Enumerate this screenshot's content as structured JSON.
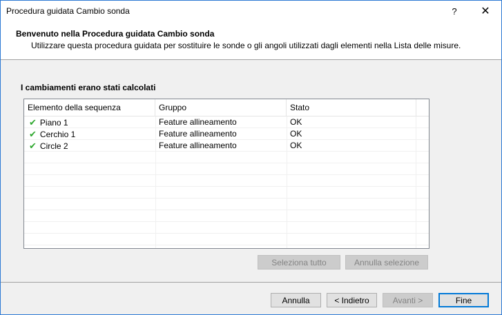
{
  "window": {
    "title": "Procedura guidata Cambio sonda",
    "help_label": "?",
    "close_label": "✕"
  },
  "header": {
    "title": "Benvenuto nella Procedura guidata Cambio sonda",
    "subtitle": "Utilizzare questa procedura guidata per sostituire le sonde o gli angoli utilizzati dagli elementi nella Lista delle misure."
  },
  "section": {
    "label": "I cambiamenti erano stati calcolati"
  },
  "table": {
    "columns": [
      "Elemento della sequenza",
      "Gruppo",
      "Stato"
    ],
    "rows": [
      {
        "element": "Piano 1",
        "group": "Feature allineamento",
        "status": "OK",
        "icon": "check-icon"
      },
      {
        "element": "Cerchio 1",
        "group": "Feature allineamento",
        "status": "OK",
        "icon": "check-icon"
      },
      {
        "element": "Circle 2",
        "group": "Feature allineamento",
        "status": "OK",
        "icon": "check-icon"
      }
    ]
  },
  "selection_buttons": {
    "select_all": "Seleziona tutto",
    "deselect": "Annulla selezione"
  },
  "footer": {
    "cancel": "Annulla",
    "back": "< Indietro",
    "next": "Avanti >",
    "finish": "Fine"
  },
  "colors": {
    "check": "#2fa82f",
    "window_border": "#2b78d4",
    "default_button_border": "#0078d7"
  }
}
